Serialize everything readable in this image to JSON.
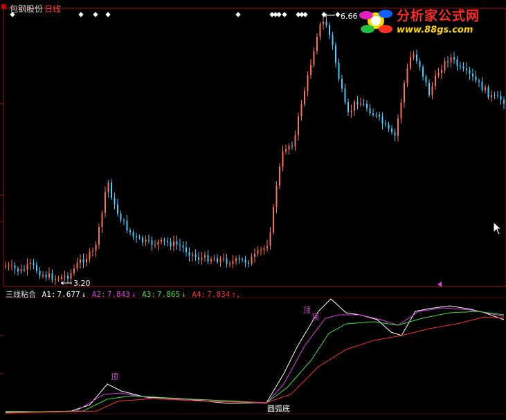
{
  "header": {
    "stock_name": "包钢股份",
    "period": "日线"
  },
  "price_panel": {
    "high_label": "6.66",
    "low_label": "3.20"
  },
  "indicator": {
    "name": "三线粘合",
    "a1": {
      "label": "A1:",
      "value": "7.677",
      "arrow": "↓",
      "color": "#ffffff"
    },
    "a2": {
      "label": "A2:",
      "value": "7.843",
      "arrow": "↓",
      "color": "#e040e0"
    },
    "a3": {
      "label": "A3:",
      "value": "7.865",
      "arrow": "↓",
      "color": "#40e040"
    },
    "a4": {
      "label": "A4:",
      "value": "7.834",
      "arrow": "↑,",
      "color": "#ff3030"
    },
    "annotations": {
      "top_1": "顶",
      "top_2": "顶",
      "top_3": "顶",
      "round_bottom": "圆弧底"
    }
  },
  "logo": {
    "title": "分析家公式网",
    "url": "www.88gs.com"
  },
  "colors": {
    "up": "#ff7050",
    "down": "#40d0ff",
    "border": "#a01010",
    "a1": "#ffffff",
    "a2": "#e040e0",
    "a3": "#40e040",
    "a4": "#ff3030"
  }
}
